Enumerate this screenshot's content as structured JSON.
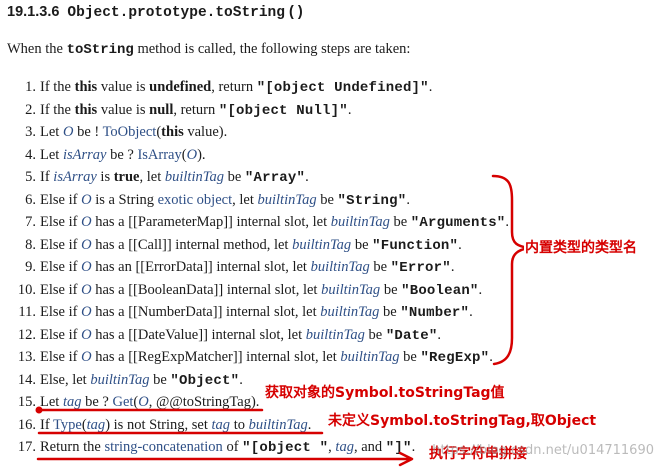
{
  "heading": {
    "number": "19.1.3.6",
    "object": "Object.prototype.toString",
    "parens": " ( )"
  },
  "intro": {
    "before": "When the ",
    "code": "toString",
    "after": " method is called, the following steps are taken:"
  },
  "steps": [
    {
      "num": "1.",
      "parts": [
        {
          "t": "If the "
        },
        {
          "b": "this"
        },
        {
          "t": " value is "
        },
        {
          "b": "undefined"
        },
        {
          "t": ", return "
        },
        {
          "c": "\"[object Undefined]\""
        },
        {
          "t": "."
        }
      ]
    },
    {
      "num": "2.",
      "parts": [
        {
          "t": "If the "
        },
        {
          "b": "this"
        },
        {
          "t": " value is "
        },
        {
          "b": "null"
        },
        {
          "t": ", return "
        },
        {
          "c": "\"[object Null]\""
        },
        {
          "t": "."
        }
      ]
    },
    {
      "num": "3.",
      "parts": [
        {
          "t": "Let "
        },
        {
          "v": "O"
        },
        {
          "t": " be ! "
        },
        {
          "l": "ToObject"
        },
        {
          "t": "("
        },
        {
          "b": "this"
        },
        {
          "t": " value)."
        }
      ]
    },
    {
      "num": "4.",
      "parts": [
        {
          "t": "Let "
        },
        {
          "v": "isArray"
        },
        {
          "t": " be ? "
        },
        {
          "l": "IsArray"
        },
        {
          "t": "("
        },
        {
          "v": "O"
        },
        {
          "t": ")."
        }
      ]
    },
    {
      "num": "5.",
      "parts": [
        {
          "t": "If "
        },
        {
          "v": "isArray"
        },
        {
          "t": " is "
        },
        {
          "b": "true"
        },
        {
          "t": ", let "
        },
        {
          "v": "builtinTag"
        },
        {
          "t": " be "
        },
        {
          "c": "\"Array\""
        },
        {
          "t": "."
        }
      ]
    },
    {
      "num": "6.",
      "parts": [
        {
          "t": "Else if "
        },
        {
          "v": "O"
        },
        {
          "t": " is a String "
        },
        {
          "l": "exotic object"
        },
        {
          "t": ", let "
        },
        {
          "v": "builtinTag"
        },
        {
          "t": " be "
        },
        {
          "c": "\"String\""
        },
        {
          "t": "."
        }
      ]
    },
    {
      "num": "7.",
      "parts": [
        {
          "t": "Else if "
        },
        {
          "v": "O"
        },
        {
          "t": " has a [[ParameterMap]] internal slot, let "
        },
        {
          "v": "builtinTag"
        },
        {
          "t": " be "
        },
        {
          "c": "\"Arguments\""
        },
        {
          "t": "."
        }
      ]
    },
    {
      "num": "8.",
      "parts": [
        {
          "t": "Else if "
        },
        {
          "v": "O"
        },
        {
          "t": " has a [[Call]] internal method, let "
        },
        {
          "v": "builtinTag"
        },
        {
          "t": " be "
        },
        {
          "c": "\"Function\""
        },
        {
          "t": "."
        }
      ]
    },
    {
      "num": "9.",
      "parts": [
        {
          "t": "Else if "
        },
        {
          "v": "O"
        },
        {
          "t": " has an [[ErrorData]] internal slot, let "
        },
        {
          "v": "builtinTag"
        },
        {
          "t": " be "
        },
        {
          "c": "\"Error\""
        },
        {
          "t": "."
        }
      ]
    },
    {
      "num": "10.",
      "parts": [
        {
          "t": "Else if "
        },
        {
          "v": "O"
        },
        {
          "t": " has a [[BooleanData]] internal slot, let "
        },
        {
          "v": "builtinTag"
        },
        {
          "t": " be "
        },
        {
          "c": "\"Boolean\""
        },
        {
          "t": "."
        }
      ]
    },
    {
      "num": "11.",
      "parts": [
        {
          "t": "Else if "
        },
        {
          "v": "O"
        },
        {
          "t": " has a [[NumberData]] internal slot, let "
        },
        {
          "v": "builtinTag"
        },
        {
          "t": " be "
        },
        {
          "c": "\"Number\""
        },
        {
          "t": "."
        }
      ]
    },
    {
      "num": "12.",
      "parts": [
        {
          "t": "Else if "
        },
        {
          "v": "O"
        },
        {
          "t": " has a [[DateValue]] internal slot, let "
        },
        {
          "v": "builtinTag"
        },
        {
          "t": " be "
        },
        {
          "c": "\"Date\""
        },
        {
          "t": "."
        }
      ]
    },
    {
      "num": "13.",
      "parts": [
        {
          "t": "Else if "
        },
        {
          "v": "O"
        },
        {
          "t": " has a [[RegExpMatcher]] internal slot, let "
        },
        {
          "v": "builtinTag"
        },
        {
          "t": " be "
        },
        {
          "c": "\"RegExp\""
        },
        {
          "t": "."
        }
      ]
    },
    {
      "num": "14.",
      "parts": [
        {
          "t": "Else, let "
        },
        {
          "v": "builtinTag"
        },
        {
          "t": " be "
        },
        {
          "c": "\"Object\""
        },
        {
          "t": "."
        }
      ]
    },
    {
      "num": "15.",
      "parts": [
        {
          "t": "Let "
        },
        {
          "v": "tag"
        },
        {
          "t": " be ? "
        },
        {
          "l": "Get"
        },
        {
          "t": "("
        },
        {
          "v": "O"
        },
        {
          "t": ", @@toStringTag)."
        }
      ]
    },
    {
      "num": "16.",
      "parts": [
        {
          "t": "If "
        },
        {
          "l": "Type"
        },
        {
          "t": "("
        },
        {
          "v": "tag"
        },
        {
          "t": ") is not String, set "
        },
        {
          "v": "tag"
        },
        {
          "t": " to "
        },
        {
          "v": "builtinTag"
        },
        {
          "t": "."
        }
      ]
    },
    {
      "num": "17.",
      "parts": [
        {
          "t": "Return the "
        },
        {
          "l": "string-concatenation"
        },
        {
          "t": " of "
        },
        {
          "c": "\"[object \""
        },
        {
          "t": ", "
        },
        {
          "v": "tag"
        },
        {
          "t": ", and "
        },
        {
          "c": "\"]\""
        },
        {
          "t": "."
        }
      ]
    }
  ],
  "annotations": {
    "builtin_types": "内置类型的类型名",
    "get_tag": "获取对象的Symbol.toStringTag值",
    "undefined_tag": "未定义Symbol.toStringTag,取Object",
    "concat": "执行字符串拼接"
  },
  "watermark": "https://blog.csdn.net/u014711690",
  "colors": {
    "annotation": "#d60000",
    "link": "#2e4f86",
    "text": "#1b1b1b"
  }
}
